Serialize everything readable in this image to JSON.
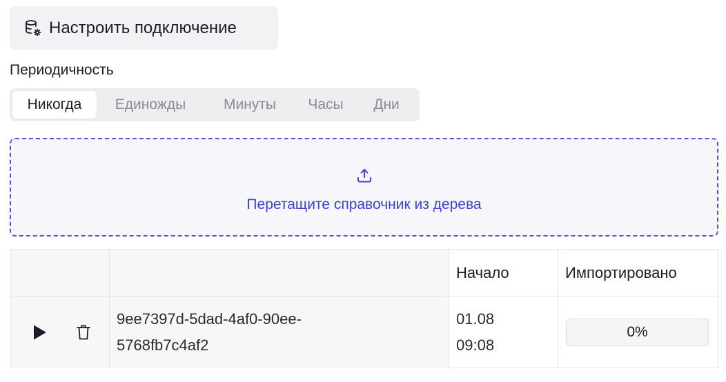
{
  "connect_button": {
    "label": "Настроить подключение",
    "icon": "database-settings-icon"
  },
  "periodicity": {
    "title": "Периодичность",
    "options": [
      "Никогда",
      "Единожды",
      "Минуты",
      "Часы",
      "Дни"
    ],
    "selected": "Никогда"
  },
  "dropzone": {
    "icon": "upload-icon",
    "text": "Перетащите справочник из дерева"
  },
  "table": {
    "columns": [
      "",
      "",
      "Начало",
      "Импортировано"
    ],
    "rows": [
      {
        "id_line1": "9ee7397d-5dad-4af0-90ee-",
        "id_line2": "5768fb7c4af2",
        "start_date": "01.08",
        "start_time": "09:08",
        "imported": "0%",
        "imported_fraction": 0
      }
    ]
  },
  "colors": {
    "accent": "#3c41d3",
    "dropzone_border": "#4f56d6"
  }
}
